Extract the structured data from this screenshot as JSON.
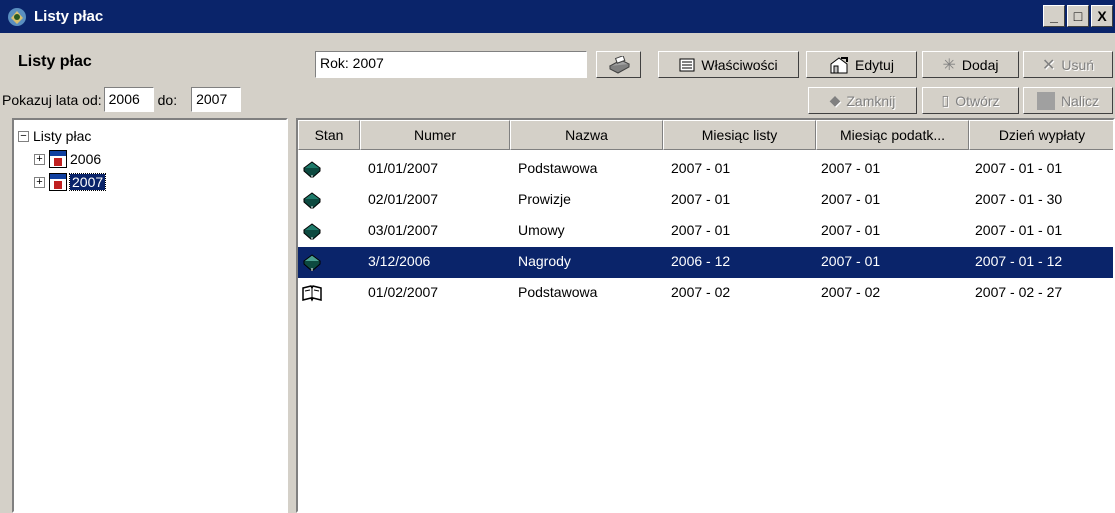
{
  "window": {
    "title": "Listy płac",
    "minimize": "_",
    "maximize": "□",
    "close": "X"
  },
  "panel": {
    "heading": "Listy płac",
    "years_label_from": "Pokazuj lata od:",
    "year_from": "2006",
    "years_label_to": "do:",
    "year_to": "2007"
  },
  "toolbar": {
    "rok": "Rok: 2007",
    "properties": "Właściwości",
    "edit": "Edytuj",
    "add": "Dodaj",
    "delete": "Usuń",
    "close_list": "Zamknij",
    "open_list": "Otwórz",
    "calculate": "Nalicz"
  },
  "tree": {
    "root": "Listy płac",
    "years": [
      "2006",
      "2007"
    ],
    "selected": "2007"
  },
  "table": {
    "columns": [
      "Stan",
      "Numer",
      "Nazwa",
      "Miesiąc listy",
      "Miesiąc podatk...",
      "Dzień wypłaty"
    ],
    "rows": [
      {
        "state": "closed",
        "numer": "01/01/2007",
        "nazwa": "Podstawowa",
        "miesiac_listy": "2007 - 01",
        "miesiac_podatk": "2007 - 01",
        "dzien_wyplaty": "2007 - 01 - 01"
      },
      {
        "state": "closed",
        "numer": "02/01/2007",
        "nazwa": "Prowizje",
        "miesiac_listy": "2007 - 01",
        "miesiac_podatk": "2007 - 01",
        "dzien_wyplaty": "2007 - 01 - 30"
      },
      {
        "state": "closed",
        "numer": "03/01/2007",
        "nazwa": "Umowy",
        "miesiac_listy": "2007 - 01",
        "miesiac_podatk": "2007 - 01",
        "dzien_wyplaty": "2007 - 01 - 01"
      },
      {
        "state": "closed",
        "numer": "3/12/2006",
        "nazwa": "Nagrody",
        "miesiac_listy": "2006 - 12",
        "miesiac_podatk": "2007 - 01",
        "dzien_wyplaty": "2007 - 01 - 12",
        "selected": true
      },
      {
        "state": "open",
        "numer": "01/02/2007",
        "nazwa": "Podstawowa",
        "miesiac_listy": "2007 - 02",
        "miesiac_podatk": "2007 - 02",
        "dzien_wyplaty": "2007 - 02 - 27"
      }
    ]
  },
  "icons": {
    "app": "payroll-app-icon",
    "closed_list": "closed-book-icon",
    "open_list": "open-book-icon",
    "year_node": "calendar-icon"
  },
  "colors": {
    "titlebar": "#0a246a",
    "selection": "#0a246a",
    "book": "#1e7a6a"
  }
}
